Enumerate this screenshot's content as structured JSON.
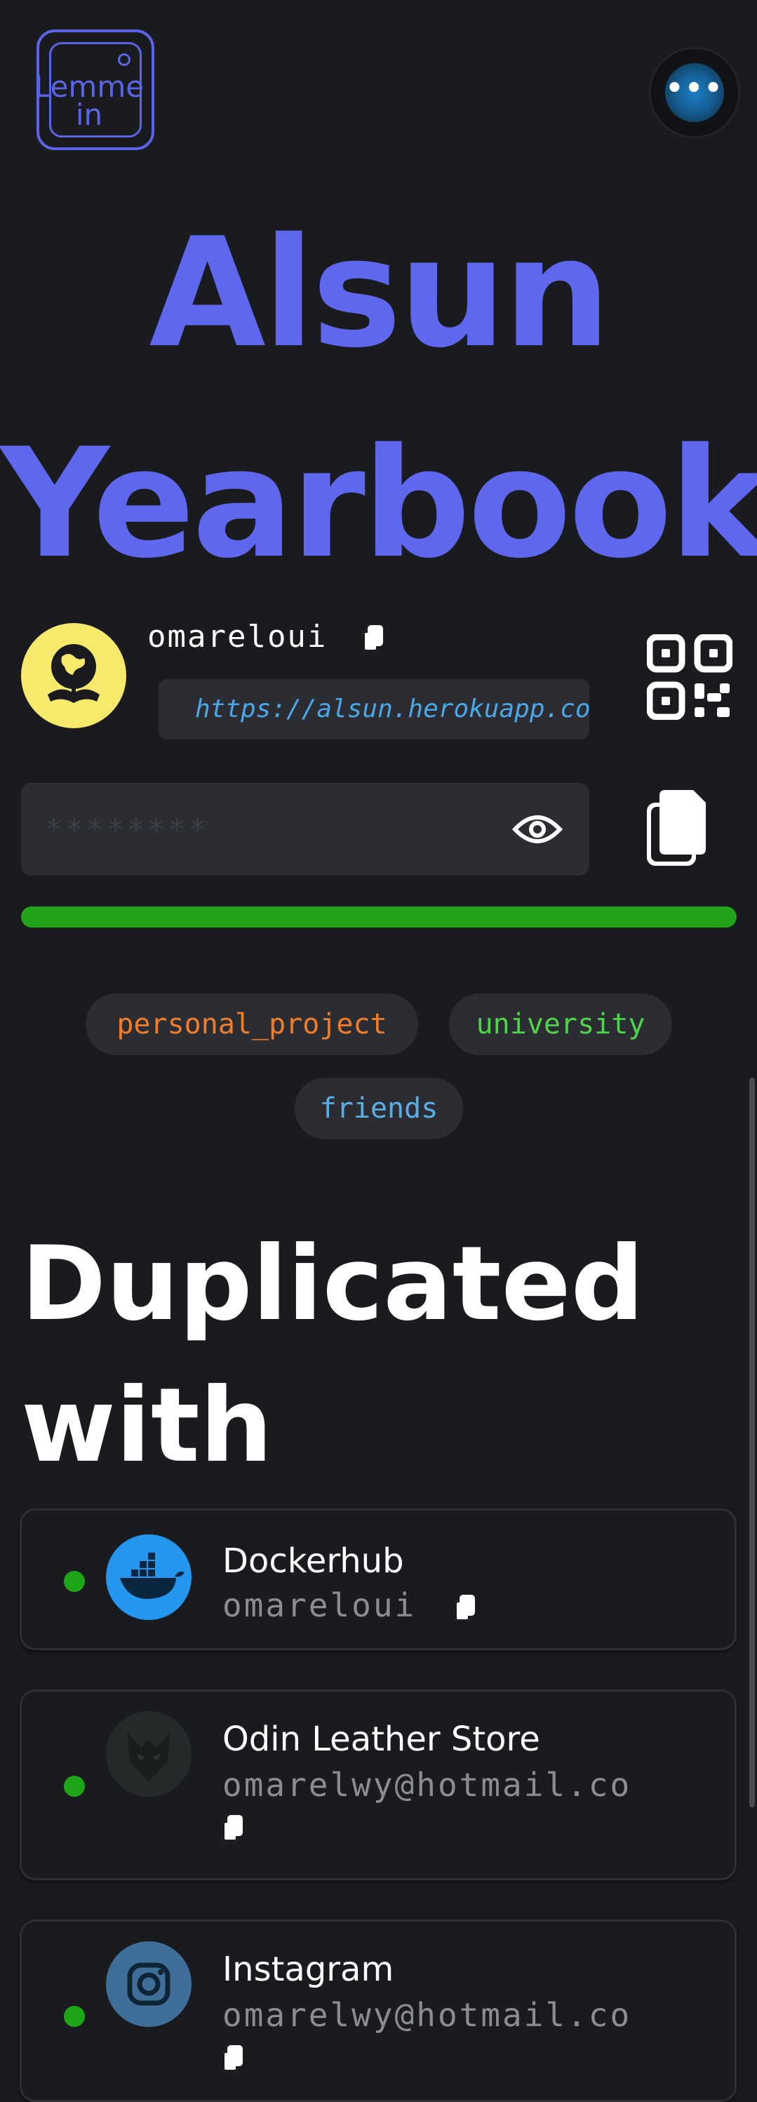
{
  "header": {
    "logo_text": "Lemme in",
    "menu_icon": "ellipsis-icon"
  },
  "title": {
    "line1": "Alsun",
    "line2": "Yearbook"
  },
  "account": {
    "username": "omareloui",
    "url": "https://alsun.herokuapp.co",
    "password_masked": "********"
  },
  "tags": [
    {
      "label": "personal_project",
      "color": "#ef7d2a"
    },
    {
      "label": "university",
      "color": "#4fd34a"
    },
    {
      "label": "friends",
      "color": "#5aaee6"
    }
  ],
  "duplicated": {
    "heading_line1": "Duplicated",
    "heading_line2": "with",
    "items": [
      {
        "name": "Dockerhub",
        "identity": "omareloui",
        "icon": "docker-icon",
        "status_color": "#1fa51a"
      },
      {
        "name": "Odin Leather Store",
        "identity": "omarelwy@hotmail.co",
        "icon": "odin-mask-icon",
        "status_color": "#1fa51a"
      },
      {
        "name": "Instagram",
        "identity": "omarelwy@hotmail.co",
        "icon": "instagram-icon",
        "status_color": "#1fa51a"
      }
    ]
  },
  "colors": {
    "accent": "#5f67ee",
    "background": "#1a1b1e",
    "strength_bar": "#21a31c"
  }
}
